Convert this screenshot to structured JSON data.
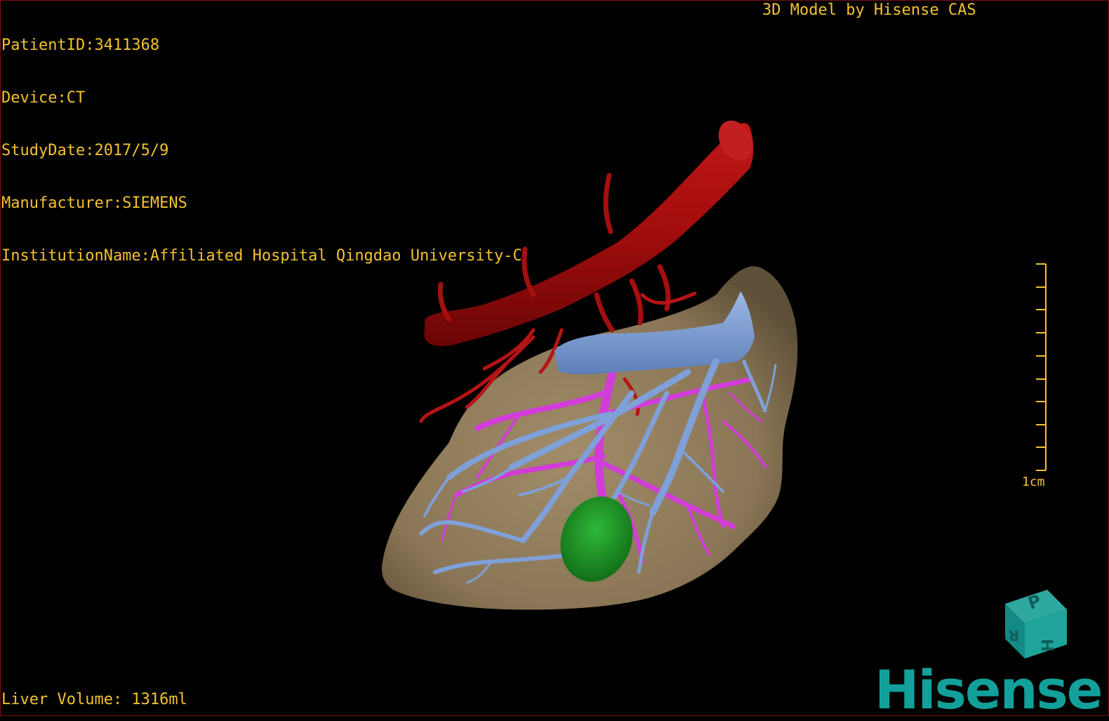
{
  "header": {
    "patient_id": "PatientID:3411368",
    "device": "Device:CT",
    "study_date": "StudyDate:2017/5/9",
    "manufacturer": "Manufacturer:SIEMENS",
    "institution": "InstitutionName:Affiliated Hospital Qingdao University-C"
  },
  "model_label": "3D Model by Hisense CAS",
  "footer": {
    "liver_volume": "Liver Volume: 1316ml"
  },
  "scale_bar": {
    "label": "1cm",
    "ticks": 10
  },
  "brand": {
    "name": "Hisense",
    "cube_letters": [
      "P",
      "H",
      "R"
    ]
  },
  "colors": {
    "text": "#f2c230",
    "liver": "#8c7a5a",
    "artery": "#b01010",
    "portal_vein": "#7fa0d8",
    "hepatic_vein": "#d23cd8",
    "gallbladder": "#1f9a28",
    "brand": "#13a09a"
  },
  "structures": [
    "liver",
    "aorta",
    "portal-vein",
    "hepatic-vein",
    "gallbladder"
  ]
}
